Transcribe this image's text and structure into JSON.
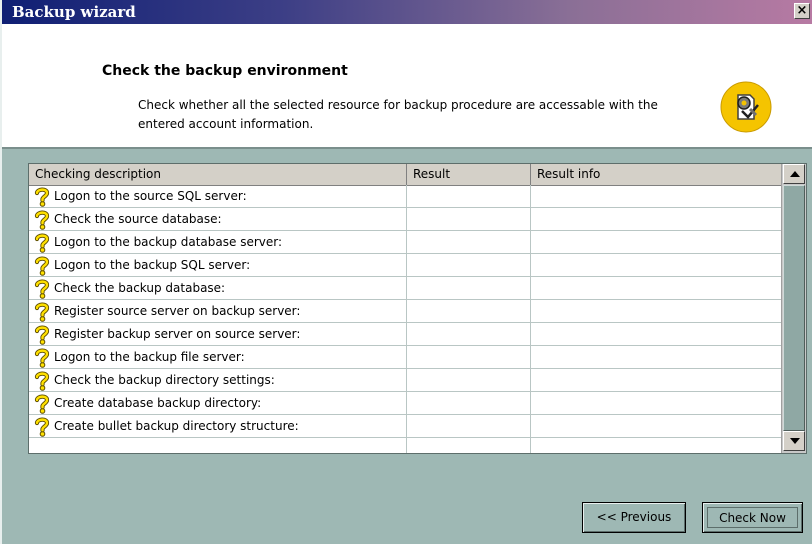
{
  "window": {
    "title": "Backup wizard",
    "close_label": "×"
  },
  "header": {
    "title": "Check the backup environment",
    "description": "Check whether all the selected resource for backup procedure are accessable with the entered account information.",
    "icon": "wizard-gear-badge-icon"
  },
  "grid": {
    "columns": [
      "Checking description",
      "Result",
      "Result info"
    ],
    "rows": [
      {
        "description": "Logon to the source SQL server:",
        "result": "",
        "info": "",
        "status_icon": "question-mark-icon"
      },
      {
        "description": "Check the source database:",
        "result": "",
        "info": "",
        "status_icon": "question-mark-icon"
      },
      {
        "description": "Logon to the backup database server:",
        "result": "",
        "info": "",
        "status_icon": "question-mark-icon"
      },
      {
        "description": "Logon to the backup SQL server:",
        "result": "",
        "info": "",
        "status_icon": "question-mark-icon"
      },
      {
        "description": "Check the backup database:",
        "result": "",
        "info": "",
        "status_icon": "question-mark-icon"
      },
      {
        "description": "Register source server on backup server:",
        "result": "",
        "info": "",
        "status_icon": "question-mark-icon"
      },
      {
        "description": "Register backup server on source server:",
        "result": "",
        "info": "",
        "status_icon": "question-mark-icon"
      },
      {
        "description": "Logon to the backup file server:",
        "result": "",
        "info": "",
        "status_icon": "question-mark-icon"
      },
      {
        "description": "Check the backup directory settings:",
        "result": "",
        "info": "",
        "status_icon": "question-mark-icon"
      },
      {
        "description": "Create database backup directory:",
        "result": "",
        "info": "",
        "status_icon": "question-mark-icon"
      },
      {
        "description": "Create bullet backup directory structure:",
        "result": "",
        "info": "",
        "status_icon": "question-mark-icon"
      },
      {
        "description": "",
        "result": "",
        "info": "",
        "status_icon": ""
      }
    ]
  },
  "buttons": {
    "previous_label": "<< Previous",
    "check_now_label": "Check Now"
  },
  "colors": {
    "title_gradient_start": "#0f1f74",
    "title_gradient_end": "#b77aa3",
    "background": "#9eb8b4",
    "icon_yellow": "#f5c400"
  }
}
